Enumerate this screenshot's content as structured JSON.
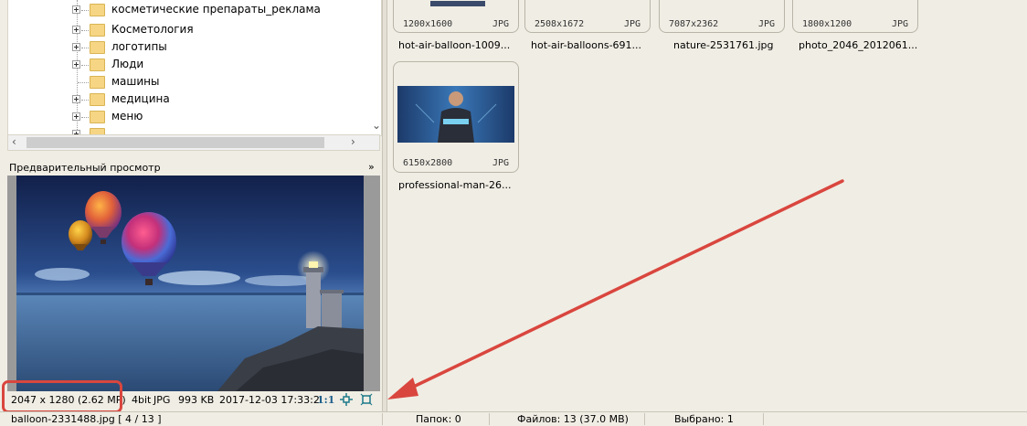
{
  "tree": {
    "items": [
      {
        "label": "косметические препараты_реклама",
        "expandable": true
      },
      {
        "label": "Косметология",
        "expandable": true
      },
      {
        "label": "логотипы",
        "expandable": true
      },
      {
        "label": "Люди",
        "expandable": true
      },
      {
        "label": "машины",
        "expandable": false
      },
      {
        "label": "медицина",
        "expandable": true
      },
      {
        "label": "меню",
        "expandable": true
      }
    ]
  },
  "preview": {
    "title": "Предварительный просмотр",
    "info": {
      "dimensions": "2047 x 1280 (2.62 MP)",
      "bitdepth": "4bit",
      "format": "JPG",
      "size": "993 KB",
      "date": "2017-12-03 17:33:2",
      "zoom_label": "1:1"
    }
  },
  "thumbnails": [
    {
      "dims": "1200x1600",
      "ext": "JPG",
      "name": "hot-air-balloon-1009..."
    },
    {
      "dims": "2508x1672",
      "ext": "JPG",
      "name": "hot-air-balloons-691..."
    },
    {
      "dims": "7087x2362",
      "ext": "JPG",
      "name": "nature-2531761.jpg"
    },
    {
      "dims": "1800x1200",
      "ext": "JPG",
      "name": "photo_2046_2012061..."
    },
    {
      "dims": "6150x2800",
      "ext": "JPG",
      "name": "professional-man-26..."
    }
  ],
  "status": {
    "file": "balloon-2331488.jpg [ 4 / 13 ]",
    "folders": "Папок: 0",
    "files": "Файлов: 13 (37.0 MB)",
    "selected": "Выбрано: 1"
  },
  "colors": {
    "highlight": "#d9463e",
    "arrow": "#d9463e",
    "folder": "#f6d684"
  }
}
